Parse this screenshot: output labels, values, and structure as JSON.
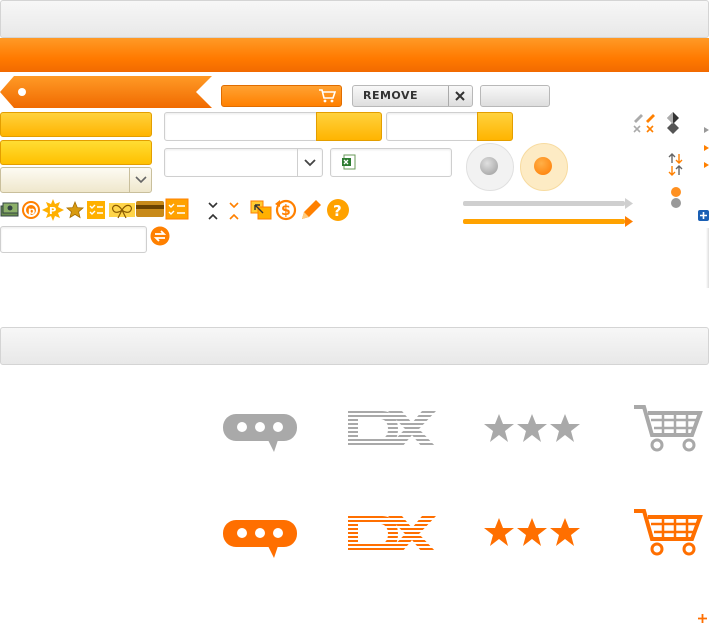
{
  "colors": {
    "orange": "#ff8000",
    "yellow": "#ffb400",
    "grey": "#a9a9a9",
    "light_grey": "#e8e8e8"
  },
  "buttons": {
    "remove_label": "REMOVE"
  },
  "icons": {
    "top_left_row": [
      "money-icon",
      "points-p-icon",
      "sun-p-icon",
      "star-icon",
      "checklist-icon",
      "ribbon-icon",
      "card-icon",
      "checklist-square-icon"
    ],
    "middle_row": [
      "collapse-up-icon",
      "collapse-down-icon",
      "cursor-icon",
      "refresh-dollar-icon",
      "pencil-icon",
      "help-icon"
    ],
    "showcase_grey": [
      "speech-bubble-icon",
      "dx-logo-icon",
      "three-stars-icon",
      "shopping-cart-icon"
    ],
    "showcase_orange": [
      "speech-bubble-icon",
      "dx-logo-icon",
      "three-stars-icon",
      "shopping-cart-icon"
    ]
  }
}
